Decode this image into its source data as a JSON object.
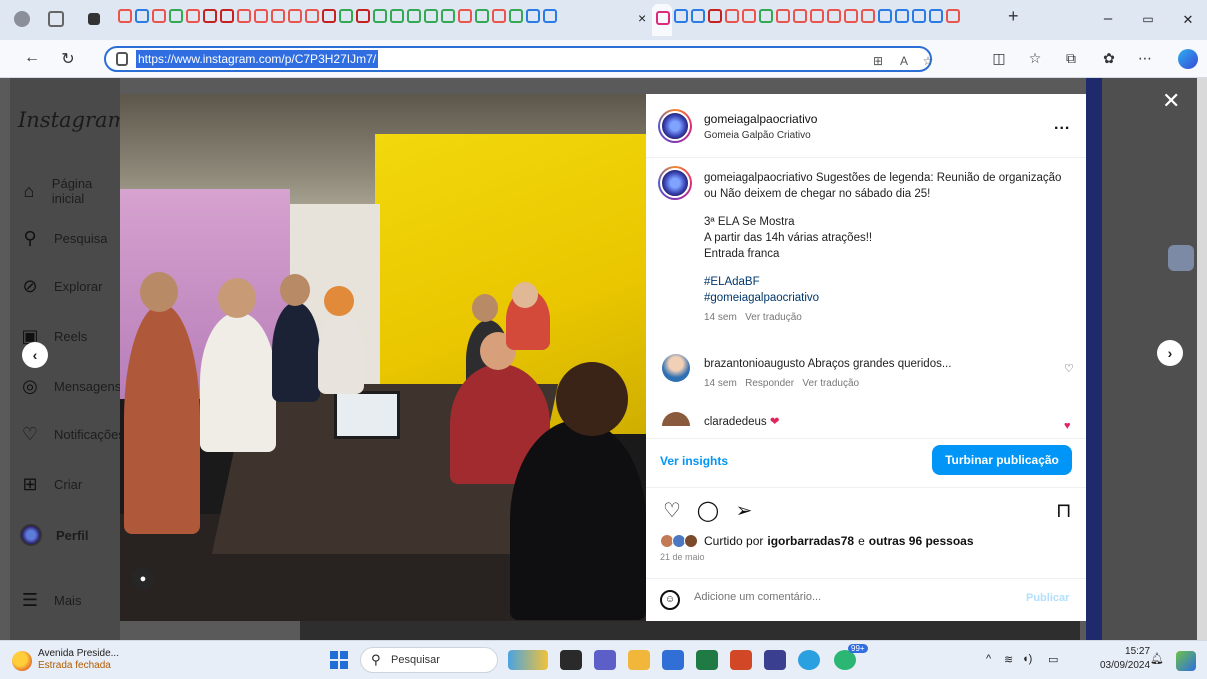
{
  "browser": {
    "url": "https://www.instagram.com/p/C7P3H27IJm7/",
    "window_controls": {
      "minimize": "–",
      "restore": "▭",
      "close": "✕"
    },
    "new_tab": "+",
    "tab_close": "×"
  },
  "instagram": {
    "logo": "Instagram",
    "nav": [
      {
        "icon": "home-icon",
        "label": "Página inicial"
      },
      {
        "icon": "search-icon",
        "label": "Pesquisa"
      },
      {
        "icon": "explore-icon",
        "label": "Explorar"
      },
      {
        "icon": "reels-icon",
        "label": "Reels"
      },
      {
        "icon": "messenger-icon",
        "label": "Mensagens"
      },
      {
        "icon": "heart-icon",
        "label": "Notificações"
      },
      {
        "icon": "create-icon",
        "label": "Criar"
      },
      {
        "icon": "avatar",
        "label": "Perfil"
      },
      {
        "icon": "menu-icon",
        "label": "Mais"
      }
    ]
  },
  "post": {
    "username": "gomeiagalpaocriativo",
    "subtitle": "Gomeia Galpão Criativo",
    "more": "...",
    "caption": {
      "author": "gomeiagalpaocriativo",
      "text": "Sugestões de legenda: Reunião de organização ou Não deixem de chegar no sábado dia 25!",
      "line1": "3ª ELA Se Mostra",
      "line2": "A partir das 14h várias atrações!!",
      "line3": "Entrada franca",
      "hashtag1": "#ELAdaBF",
      "hashtag2": "#gomeiagalpaocriativo",
      "time": "14 sem",
      "translate": "Ver tradução"
    },
    "comments": [
      {
        "user": "brazantonioaugusto",
        "text": "Abraços grandes queridos...",
        "time": "14 sem",
        "reply": "Responder",
        "translate": "Ver tradução"
      },
      {
        "user": "claradedeus",
        "text": "❤"
      }
    ],
    "insights": "Ver insights",
    "boost": "Turbinar publicação",
    "likes_prefix": "Curtido por",
    "likes_user": "igorbarradas78",
    "likes_and": "e",
    "likes_others": "outras 96 pessoas",
    "date": "21 de maio",
    "comment_placeholder": "Adicione um comentário...",
    "publish": "Publicar"
  },
  "taskbar": {
    "weather_title": "Avenida Preside...",
    "weather_sub": "Estrada fechada",
    "search": "Pesquisar",
    "badge": "99+",
    "time": "15:27",
    "date": "03/09/2024"
  },
  "colors": {
    "accent": "#0095f6",
    "url_highlight": "#2f6de0",
    "heart_red": "#e0245e"
  }
}
